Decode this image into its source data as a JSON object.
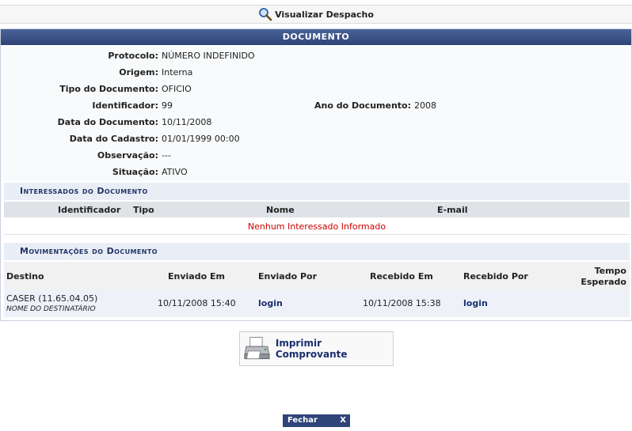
{
  "legend": {
    "title": "Visualizar Despacho",
    "icon": "magnifier-icon"
  },
  "panel": {
    "caption": "Documento"
  },
  "fields": {
    "protocolo_label": "Protocolo:",
    "protocolo": "NÚMERO INDEFINIDO",
    "origem_label": "Origem:",
    "origem": "Interna",
    "tipo_label": "Tipo do Documento:",
    "tipo": "OFICIO",
    "identificador_label": "Identificador:",
    "identificador": "99",
    "ano_label": "Ano do Documento:",
    "ano": "2008",
    "data_doc_label": "Data do Documento:",
    "data_doc": "10/11/2008",
    "data_cad_label": "Data do Cadastro:",
    "data_cad": "01/01/1999 00:00",
    "obs_label": "Observação:",
    "obs": "---",
    "situacao_label": "Situação:",
    "situacao": "ATIVO"
  },
  "interessados": {
    "title": "Interessados do Documento",
    "columns": [
      "Identificador",
      "Tipo",
      "Nome",
      "E-mail"
    ],
    "empty_message": "Nenhum Interessado Informado"
  },
  "movimentacoes": {
    "title": "Movimentações do Documento",
    "columns": [
      "Destino",
      "Enviado Em",
      "Enviado Por",
      "Recebido Em",
      "Recebido Por",
      "Tempo",
      "Esperado"
    ],
    "rows": [
      {
        "destino": "CASER (11.65.04.05)",
        "destinatario": "NOME DO DESTINATÁRIO",
        "enviado_em": "10/11/2008 15:40",
        "enviado_por": "login",
        "recebido_em": "10/11/2008 15:38",
        "recebido_por": "login"
      }
    ]
  },
  "actions": {
    "print": "Imprimir Comprovante",
    "print_icon": "printer-icon",
    "close": "Fechar",
    "close_x": "X"
  },
  "colors": {
    "header": "#2f4478",
    "subhead_bg": "#e9eef6",
    "error": "#cc0000",
    "link": "#1a2e6e"
  }
}
